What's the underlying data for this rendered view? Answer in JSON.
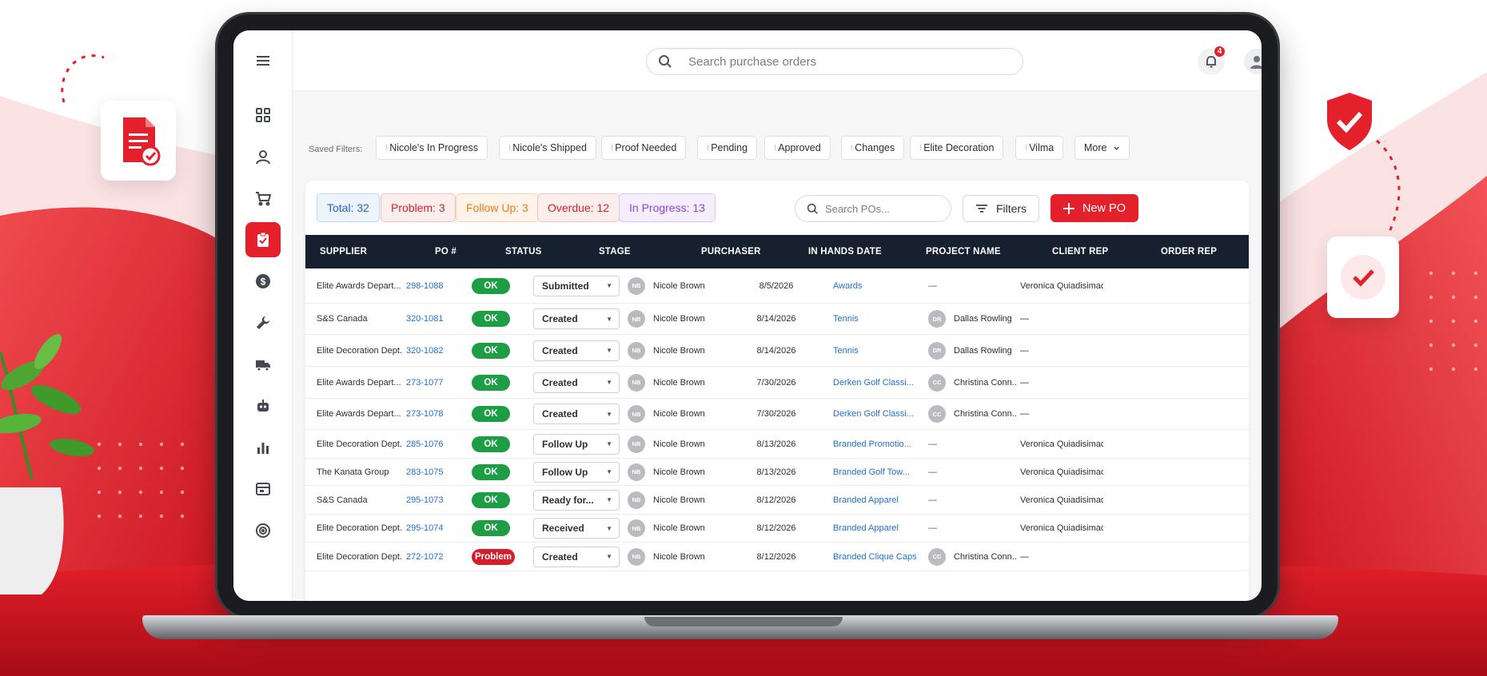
{
  "search": {
    "placeholder": "Search purchase orders"
  },
  "notifications": {
    "count": "4"
  },
  "saved_filters": {
    "label": "Saved Filters:",
    "chips": [
      "Nicole's In Progress",
      "Nicole's Shipped",
      "Proof Needed",
      "Pending",
      "Approved",
      "Changes",
      "Elite Decoration",
      "Vilma"
    ],
    "more_label": "More"
  },
  "stats": [
    {
      "label": "Total: 32",
      "color": "#1f63c9"
    },
    {
      "label": "Problem: 3",
      "color": "#d61f2b"
    },
    {
      "label": "Follow Up: 3",
      "color": "#f07a1c"
    },
    {
      "label": "Overdue: 12",
      "color": "#d61f2b"
    },
    {
      "label": "In Progress: 13",
      "color": "#8b45e0"
    }
  ],
  "toolbar": {
    "po_search_placeholder": "Search POs...",
    "filters_label": "Filters",
    "new_po_label": "New PO"
  },
  "table": {
    "columns": [
      "SUPPLIER",
      "PO #",
      "STATUS",
      "STAGE",
      "PURCHASER",
      "IN HANDS DATE",
      "PROJECT NAME",
      "CLIENT REP",
      "ORDER REP"
    ],
    "rows": [
      {
        "supplier": "Elite Awards Depart...",
        "po": "298-1088",
        "status": "OK",
        "stage": "Submitted",
        "purchaser_initials": "NB",
        "purchaser": "Nicole Brown",
        "date": "8/5/2026",
        "project": "Awards",
        "client_initials": "",
        "client": "—",
        "order_rep": "Veronica Quiadisimao"
      },
      {
        "supplier": "S&S Canada",
        "po": "320-1081",
        "status": "OK",
        "stage": "Created",
        "purchaser_initials": "NB",
        "purchaser": "Nicole Brown",
        "date": "8/14/2026",
        "project": "Tennis",
        "client_initials": "DR",
        "client": "Dallas Rowling",
        "order_rep": "—"
      },
      {
        "supplier": "Elite Decoration Dept...",
        "po": "320-1082",
        "status": "OK",
        "stage": "Created",
        "purchaser_initials": "NB",
        "purchaser": "Nicole Brown",
        "date": "8/14/2026",
        "project": "Tennis",
        "client_initials": "DR",
        "client": "Dallas Rowling",
        "order_rep": "—"
      },
      {
        "supplier": "Elite Awards Depart...",
        "po": "273-1077",
        "status": "OK",
        "stage": "Created",
        "purchaser_initials": "NB",
        "purchaser": "Nicole Brown",
        "date": "7/30/2026",
        "project": "Derken Golf Classi...",
        "client_initials": "CC",
        "client": "Christina Conn...",
        "order_rep": "—"
      },
      {
        "supplier": "Elite Awards Depart...",
        "po": "273-1078",
        "status": "OK",
        "stage": "Created",
        "purchaser_initials": "NB",
        "purchaser": "Nicole Brown",
        "date": "7/30/2026",
        "project": "Derken Golf Classi...",
        "client_initials": "CC",
        "client": "Christina Conn...",
        "order_rep": "—"
      },
      {
        "supplier": "Elite Decoration Dept...",
        "po": "285-1076",
        "status": "OK",
        "stage": "Follow Up",
        "purchaser_initials": "NB",
        "purchaser": "Nicole Brown",
        "date": "8/13/2026",
        "project": "Branded Promotio...",
        "client_initials": "",
        "client": "—",
        "order_rep": "Veronica Quiadisimao"
      },
      {
        "supplier": "The Kanata Group",
        "po": "283-1075",
        "status": "OK",
        "stage": "Follow Up",
        "purchaser_initials": "NB",
        "purchaser": "Nicole Brown",
        "date": "8/13/2026",
        "project": "Branded Golf Tow...",
        "client_initials": "",
        "client": "—",
        "order_rep": "Veronica Quiadisimao"
      },
      {
        "supplier": "S&S Canada",
        "po": "295-1073",
        "status": "OK",
        "stage": "Ready for...",
        "purchaser_initials": "NB",
        "purchaser": "Nicole Brown",
        "date": "8/12/2026",
        "project": "Branded Apparel",
        "client_initials": "",
        "client": "—",
        "order_rep": "Veronica Quiadisimao"
      },
      {
        "supplier": "Elite Decoration Dept...",
        "po": "295-1074",
        "status": "OK",
        "stage": "Received",
        "purchaser_initials": "NB",
        "purchaser": "Nicole Brown",
        "date": "8/12/2026",
        "project": "Branded Apparel",
        "client_initials": "",
        "client": "—",
        "order_rep": "Veronica Quiadisimao"
      },
      {
        "supplier": "Elite Decoration Dept...",
        "po": "272-1072",
        "status": "Problem",
        "stage": "Created",
        "purchaser_initials": "NB",
        "purchaser": "Nicole Brown",
        "date": "8/12/2026",
        "project": "Branded Clique Caps",
        "client_initials": "CC",
        "client": "Christina Conn...",
        "order_rep": "—"
      }
    ]
  },
  "theme": {
    "accent": "#e4202b",
    "header_bg": "#16202e",
    "ok": "#1e9e44",
    "link": "#1f6fd1"
  },
  "sidebar_icons": [
    "menu-icon",
    "dashboard-icon",
    "user-icon",
    "cart-icon",
    "purchase-orders-icon",
    "dollar-icon",
    "wrench-icon",
    "truck-icon",
    "robot-icon",
    "bar-chart-icon",
    "browser-icon",
    "target-icon"
  ]
}
